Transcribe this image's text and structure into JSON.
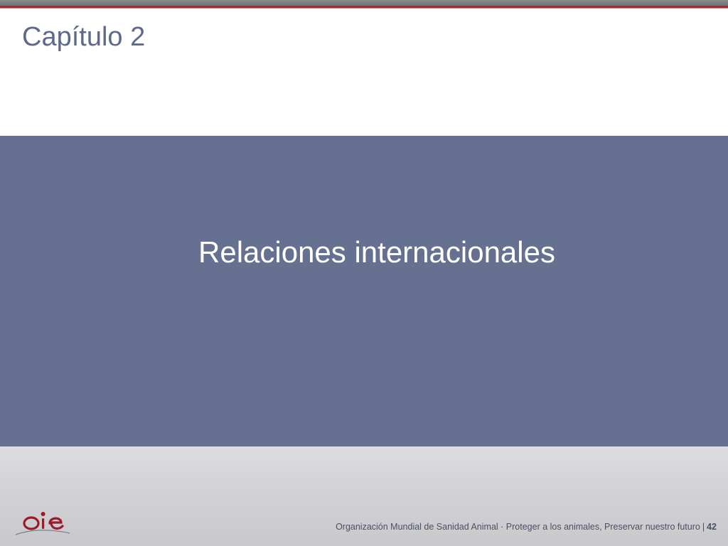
{
  "slide": {
    "chapter_title": "Capítulo 2",
    "section_title": "Relaciones internacionales"
  },
  "footer": {
    "text": "Organización Mundial de Sanidad Animal · Proteger a los animales, Preservar nuestro futuro",
    "separator": "|",
    "page_number": "42",
    "logo_text": "OIE"
  },
  "colors": {
    "band": "#667090",
    "title": "#5f6a8a",
    "accent_red": "#b3293a",
    "footer_bg": "#d2d2d4"
  }
}
